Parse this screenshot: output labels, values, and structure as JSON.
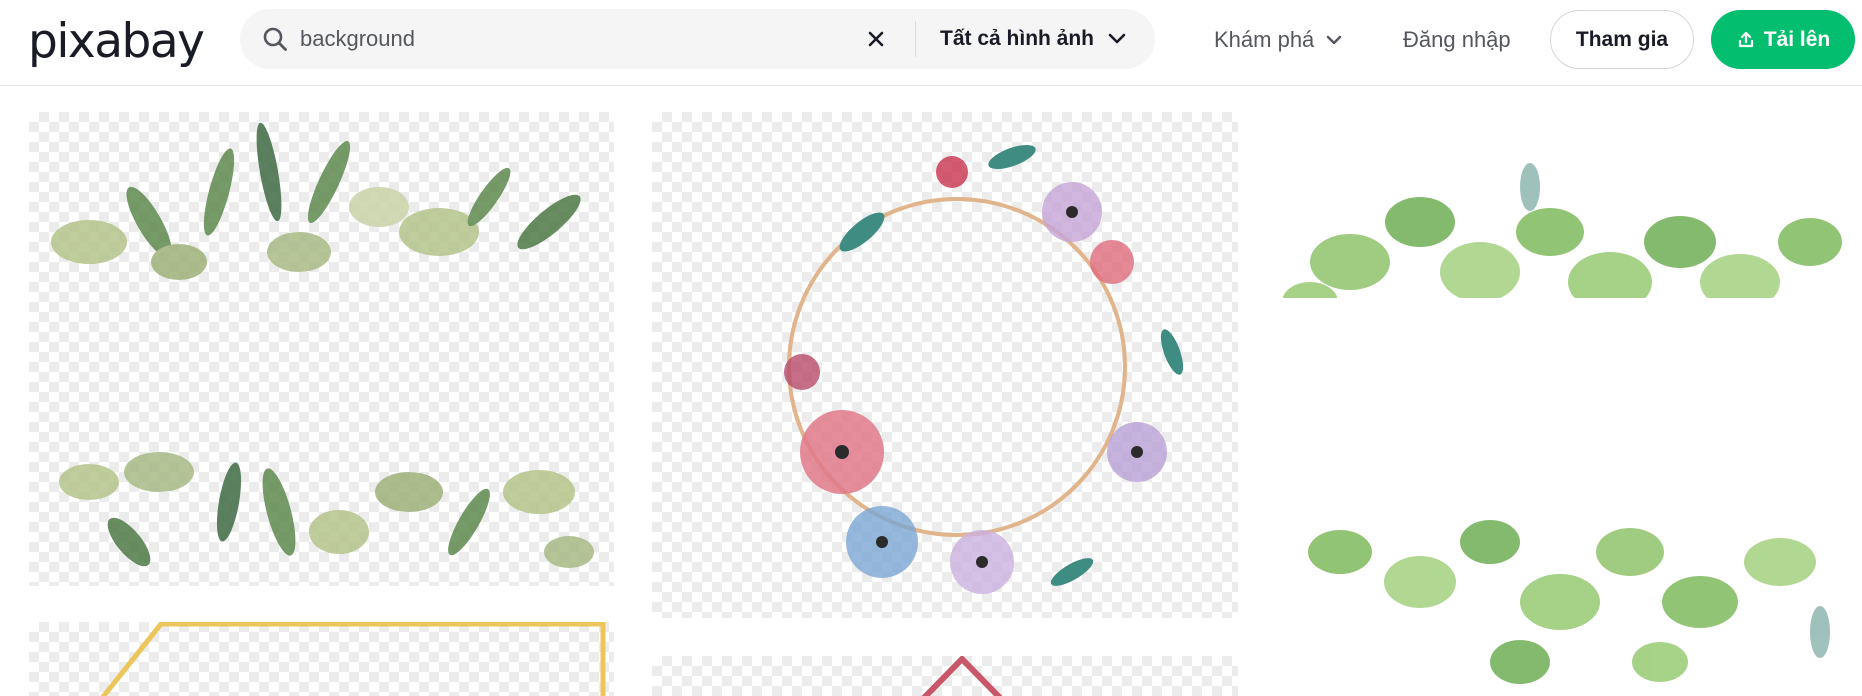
{
  "header": {
    "logo_text": "pixabay",
    "search": {
      "value": "background",
      "icon": "search-icon",
      "clear_icon": "close-icon",
      "type_label": "Tất cả hình ảnh",
      "type_icon": "chevron-down-icon"
    },
    "explore_label": "Khám phá",
    "login_label": "Đăng nhập",
    "join_label": "Tham gia",
    "upload_label": "Tải lên",
    "upload_icon": "upload-icon"
  },
  "colors": {
    "accent": "#02be6e",
    "text": "#191b26",
    "muted": "#55575e",
    "search_bg": "#f5f5f5"
  },
  "results": [
    {
      "name": "greenery-border-frame",
      "background": "transparent-checker"
    },
    {
      "name": "floral-wreath-frame",
      "background": "transparent-checker"
    },
    {
      "name": "green-leaves-border",
      "background": "white"
    },
    {
      "name": "gold-frame",
      "background": "transparent-checker"
    },
    {
      "name": "pink-frame",
      "background": "transparent-checker"
    }
  ]
}
